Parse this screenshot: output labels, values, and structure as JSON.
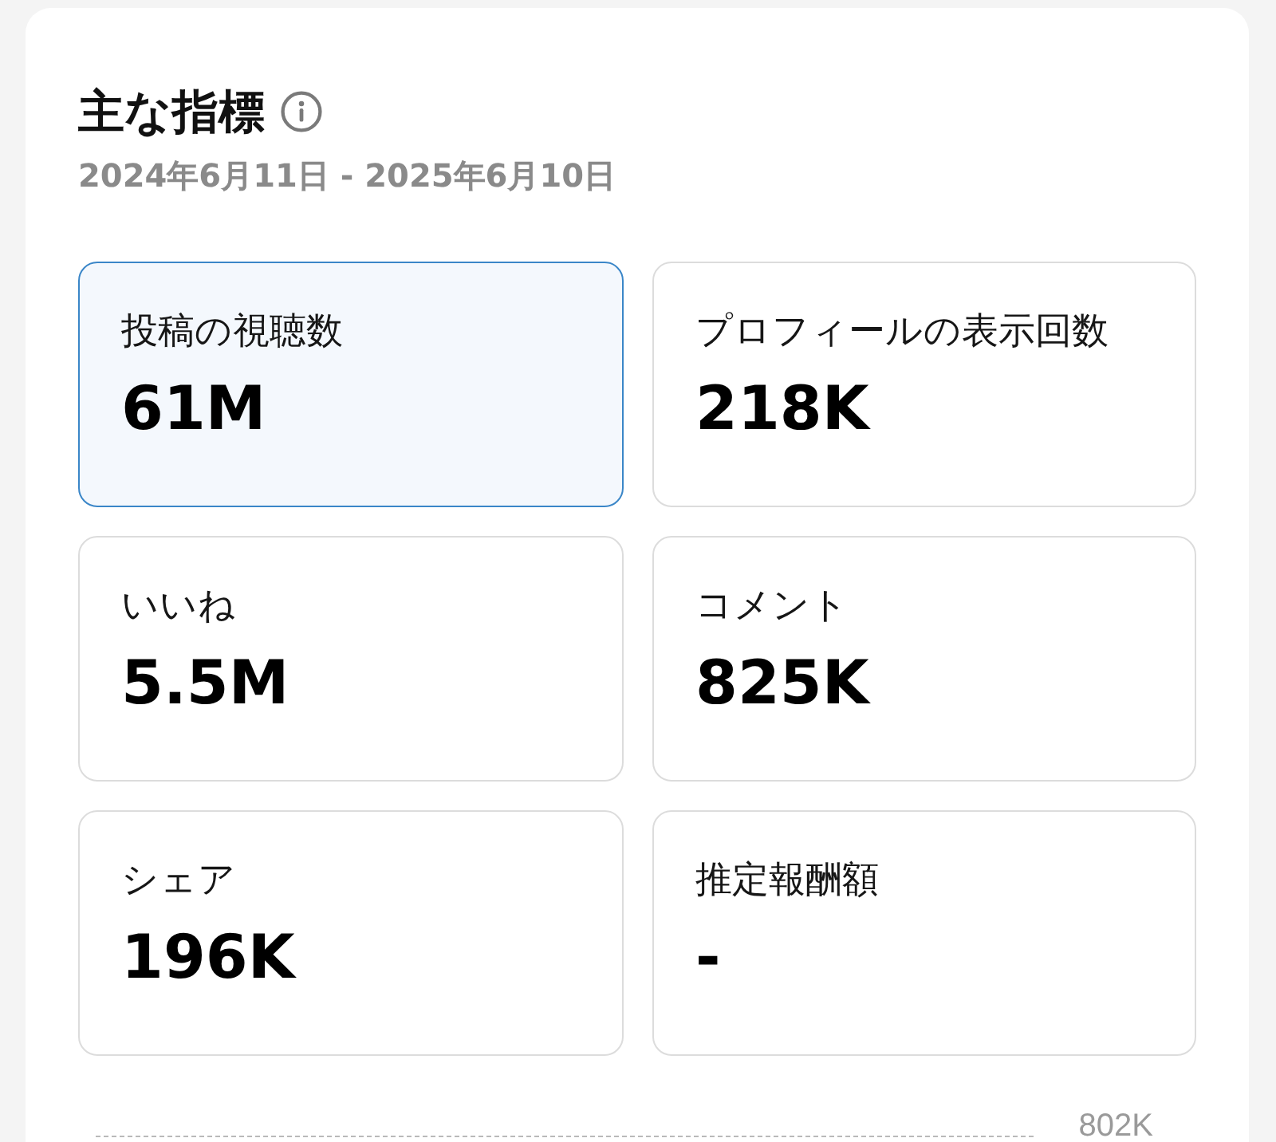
{
  "section": {
    "title": "主な指標",
    "date_range": "2024年6月11日 - 2025年6月10日"
  },
  "metrics": [
    {
      "label": "投稿の視聴数",
      "value": "61M",
      "selected": true
    },
    {
      "label": "プロフィールの表示回数",
      "value": "218K",
      "selected": false
    },
    {
      "label": "いいね",
      "value": "5.5M",
      "selected": false
    },
    {
      "label": "コメント",
      "value": "825K",
      "selected": false
    },
    {
      "label": "シェア",
      "value": "196K",
      "selected": false
    },
    {
      "label": "推定報酬額",
      "value": "-",
      "selected": false
    }
  ],
  "chart_preview": {
    "top_tick_label": "802K"
  }
}
